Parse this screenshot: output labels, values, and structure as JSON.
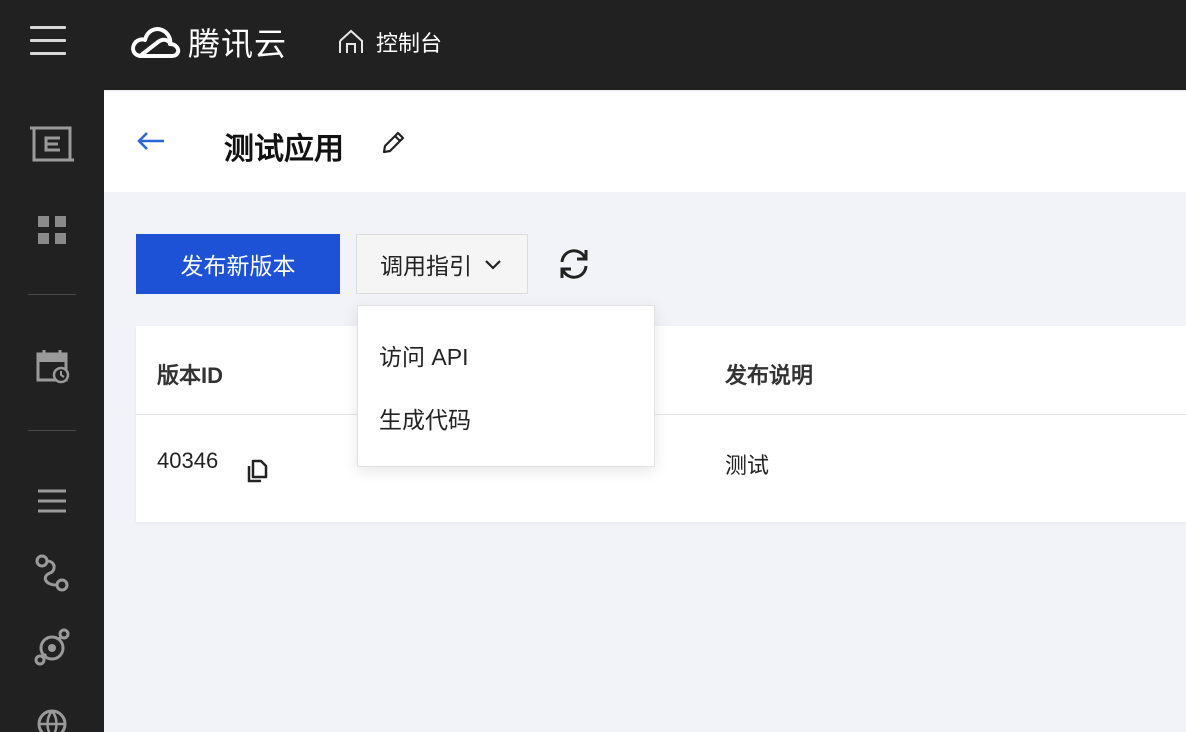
{
  "topbar": {
    "brand": "腾讯云",
    "console_label": "控制台"
  },
  "sidebar": {
    "icons": [
      "api-gateway-icon",
      "grid-icon",
      "calendar-icon",
      "list-icon",
      "flow-icon",
      "network-icon",
      "globe-icon"
    ]
  },
  "header": {
    "title": "测试应用"
  },
  "toolbar": {
    "publish_label": "发布新版本",
    "guide_label": "调用指引"
  },
  "menu": {
    "items": [
      {
        "label": "访问 API"
      },
      {
        "label": "生成代码"
      }
    ]
  },
  "table": {
    "columns": [
      "版本ID",
      "发布说明"
    ],
    "rows": [
      {
        "version_id": "40346",
        "description": "测试"
      }
    ]
  },
  "colors": {
    "topbar_bg": "#212121",
    "primary": "#1d51d6",
    "page_bg": "#f2f3f8",
    "link_blue": "#2b65d9"
  }
}
